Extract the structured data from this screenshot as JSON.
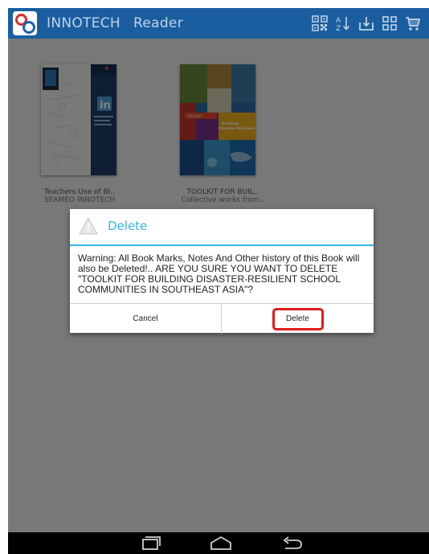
{
  "app": {
    "name": "INNOTECH",
    "subtitle": "Reader",
    "actions": [
      {
        "icon": "qr-code-icon"
      },
      {
        "icon": "sort-az-icon"
      },
      {
        "icon": "import-icon"
      },
      {
        "icon": "grid-view-icon"
      },
      {
        "icon": "cart-icon"
      }
    ]
  },
  "library": {
    "books": [
      {
        "title": "Teachers Use of Bl..",
        "author": "SEAMEO INNOTECH"
      },
      {
        "title": "TOOLKIT FOR BUIL..",
        "author": "Collective works from.."
      }
    ]
  },
  "dialog": {
    "title": "Delete",
    "icon": "warning-icon",
    "message": "Warning: All Book Marks, Notes And Other history of this Book will also be Deleted!.. ARE YOU SURE YOU WANT TO DELETE \"TOOLKIT FOR BUILDING DISASTER-RESILIENT SCHOOL COMMUNITIES IN SOUTHEAST ASIA\"?",
    "cancel_label": "Cancel",
    "delete_label": "Delete",
    "accent_color": "#33b5e5"
  },
  "navbar": {
    "icons": [
      "recent-apps-icon",
      "home-icon",
      "back-icon"
    ]
  },
  "colors": {
    "actionbar": "#1b5e9f",
    "highlight": "#e01b1b"
  }
}
